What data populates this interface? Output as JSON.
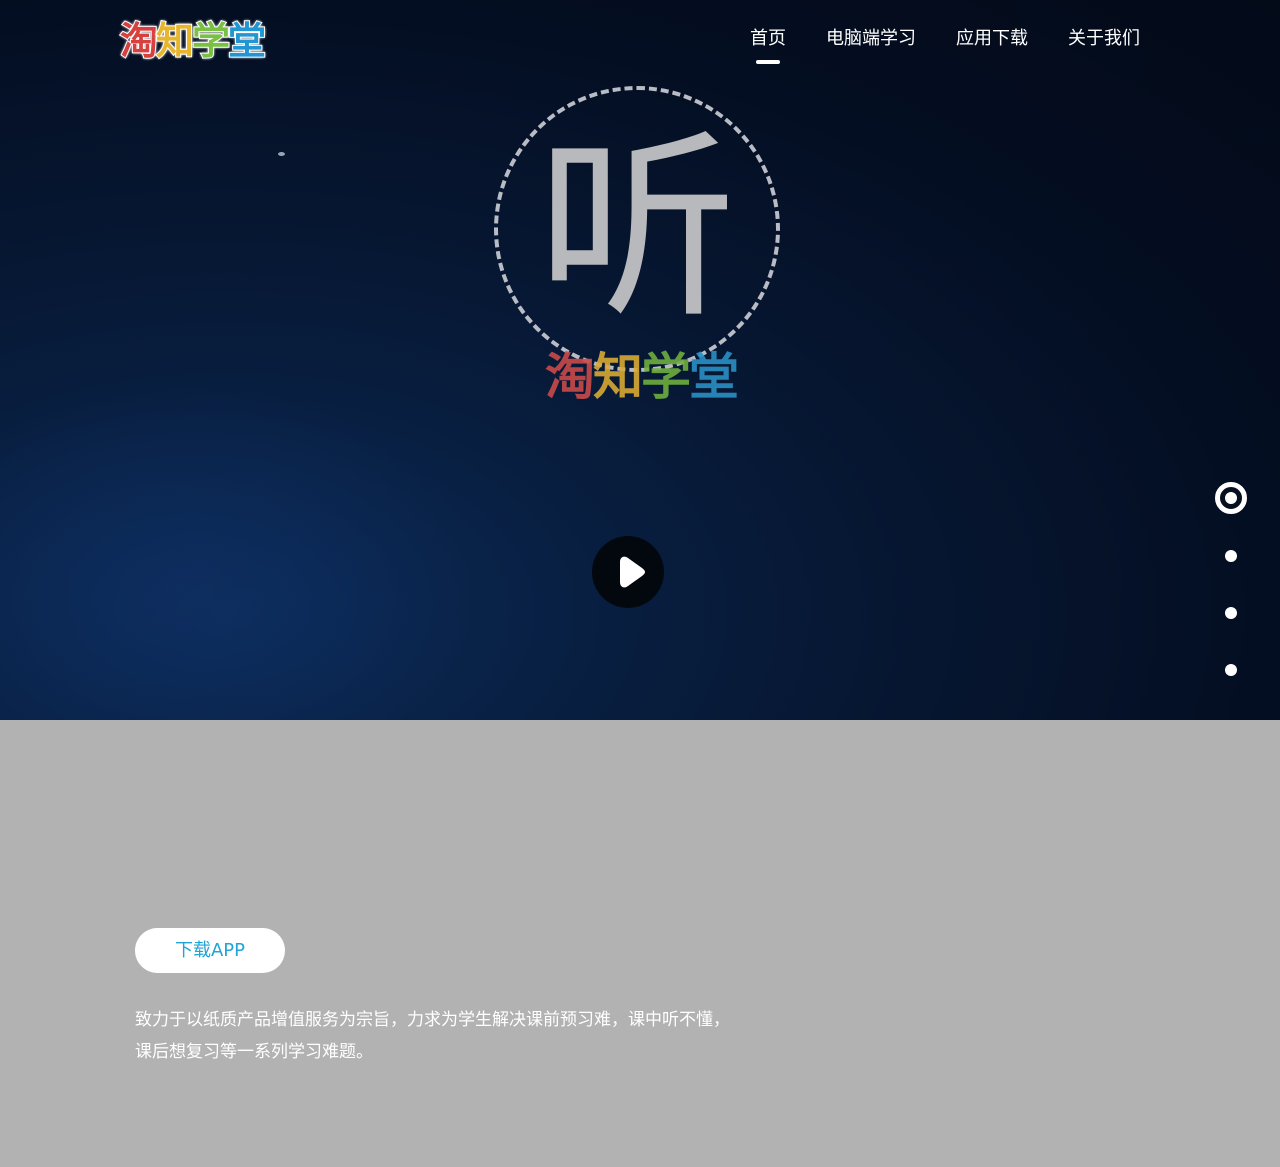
{
  "header": {
    "logo": {
      "chars": [
        "淘",
        "知",
        "学",
        "堂"
      ],
      "colors": [
        "#d6403f",
        "#e8b62c",
        "#7ac143",
        "#2196d3"
      ]
    },
    "nav": [
      {
        "label": "首页",
        "active": true
      },
      {
        "label": "电脑端学习",
        "active": false
      },
      {
        "label": "应用下载",
        "active": false
      },
      {
        "label": "关于我们",
        "active": false
      }
    ]
  },
  "hero": {
    "video_poster": {
      "character": "听",
      "brand_chars": [
        "淘",
        "知",
        "学",
        "堂"
      ]
    },
    "play_icon": "play-icon"
  },
  "section_nav": {
    "count": 4,
    "active_index": 0
  },
  "lower": {
    "download_button": "下载APP",
    "intro_text": "致力于以纸质产品增值服务为宗旨，力求为学生解决课前预习难，课中听不懂，课后想复习等一系列学习难题。"
  },
  "colors": {
    "hero_bg": "#040e22",
    "lower_bg": "#b2b2b2",
    "accent": "#21a4d6",
    "text_light": "#ffffff"
  }
}
